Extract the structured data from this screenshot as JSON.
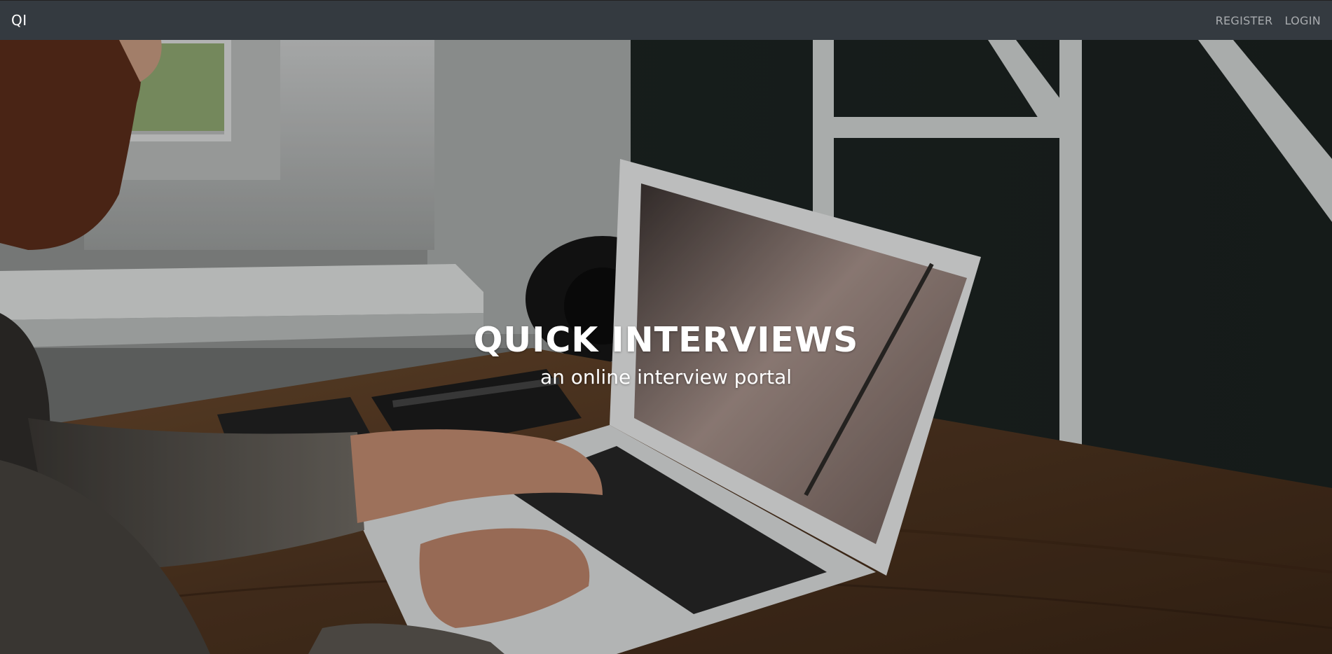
{
  "navbar": {
    "brand": "QI",
    "links": [
      {
        "label": "REGISTER"
      },
      {
        "label": "LOGIN"
      }
    ]
  },
  "hero": {
    "title": "QUICK INTERVIEWS",
    "subtitle": "an online interview portal",
    "background": "photo-person-typing-on-laptop"
  },
  "colors": {
    "navbar_bg": "#343a40",
    "nav_link": "#a9acaf",
    "brand": "#ffffff",
    "hero_text": "#ffffff"
  }
}
